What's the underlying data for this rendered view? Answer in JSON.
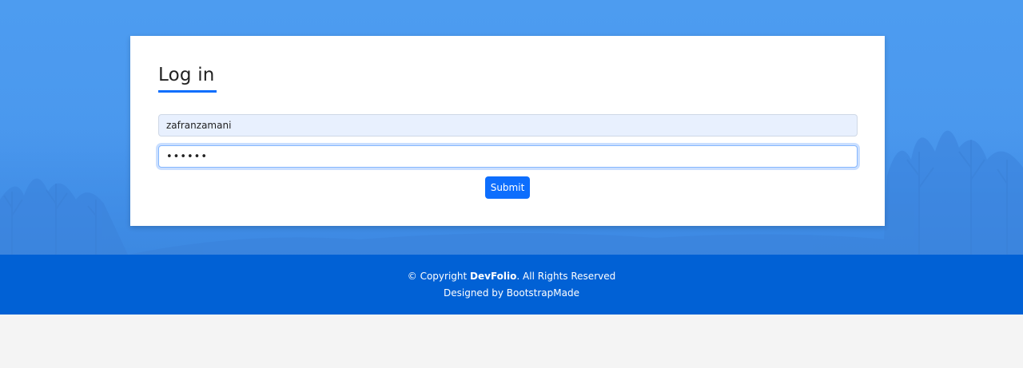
{
  "form": {
    "title": "Log in",
    "username_value": "zafranzamani",
    "password_value": "••••••",
    "submit_label": "Submit"
  },
  "footer": {
    "copyright_prefix": "© Copyright ",
    "brand": "DevFolio",
    "rights": ". All Rights Reserved",
    "designed_by_prefix": "Designed by ",
    "designer": "BootstrapMade"
  },
  "colors": {
    "hero_bg": "#4d9cf0",
    "accent": "#0d6efd",
    "footer_bg": "#0161d5",
    "page_bg": "#f4f4f4"
  }
}
